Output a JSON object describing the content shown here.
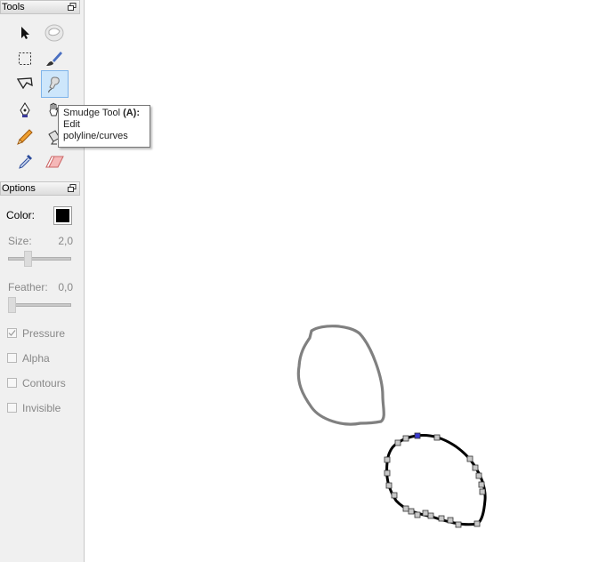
{
  "tools_panel": {
    "title": "Tools",
    "tools": [
      {
        "name": "arrow-select-icon"
      },
      {
        "name": "transform-icon"
      },
      {
        "name": "rectangle-select-icon"
      },
      {
        "name": "brush-icon"
      },
      {
        "name": "lasso-select-icon"
      },
      {
        "name": "smudge-icon",
        "active": true
      },
      {
        "name": "pen-icon"
      },
      {
        "name": "hand-icon"
      },
      {
        "name": "pencil-icon"
      },
      {
        "name": "bucket-icon"
      },
      {
        "name": "eyedropper-icon"
      },
      {
        "name": "eraser-icon"
      }
    ]
  },
  "tooltip": {
    "name": "Smudge Tool",
    "shortcut": "(A):",
    "line2": "Edit",
    "line3": "polyline/curves"
  },
  "options_panel": {
    "title": "Options",
    "color_label": "Color:",
    "color_value": "#000000",
    "size_label": "Size:",
    "size_value": "2,0",
    "size_slider_fraction": 0.3,
    "feather_label": "Feather:",
    "feather_value": "0,0",
    "feather_slider_fraction": 0.0,
    "checkboxes": [
      {
        "label": "Pressure",
        "checked": true
      },
      {
        "label": "Alpha",
        "checked": false
      },
      {
        "label": "Contours",
        "checked": false
      },
      {
        "label": "Invisible",
        "checked": false
      }
    ]
  },
  "canvas": {
    "background": "#ffffff",
    "stroke_gray": "#808080",
    "stroke_selected": "#000000",
    "handle_color": "#c8c8c8",
    "handle_active_color": "#3a3ad0"
  }
}
